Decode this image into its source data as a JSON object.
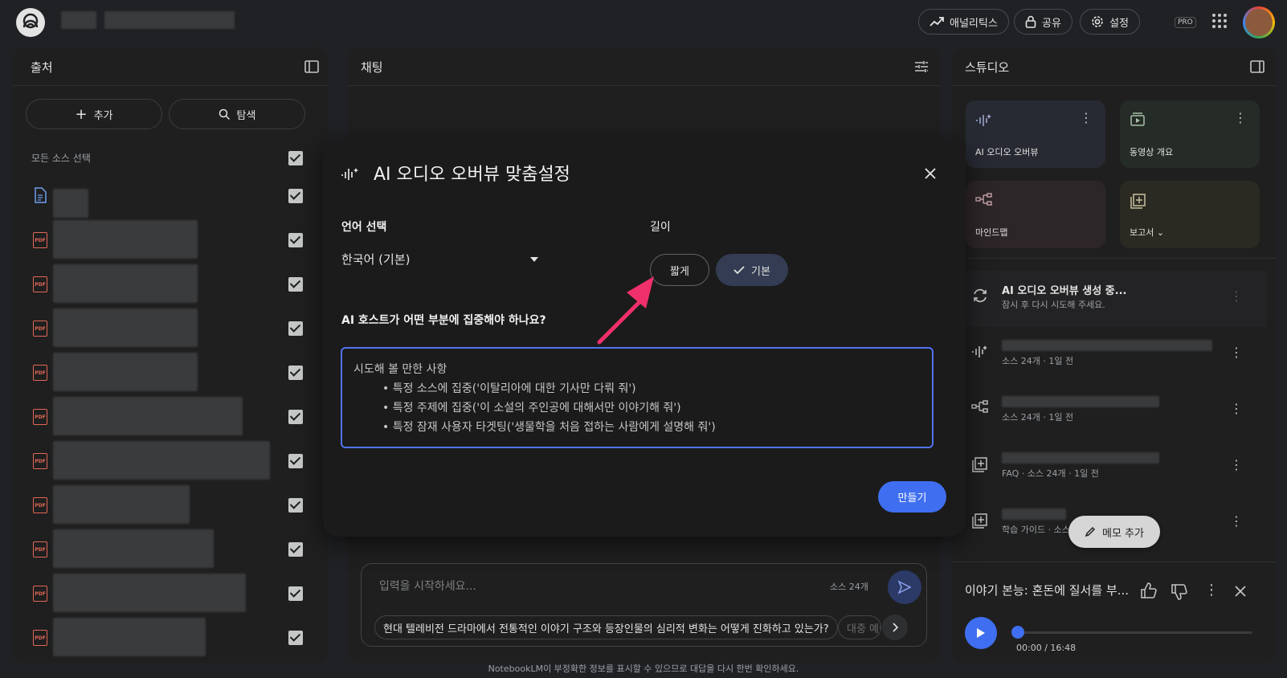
{
  "topbar": {
    "analytics": "애널리틱스",
    "share": "공유",
    "settings": "설정",
    "pro": "PRO"
  },
  "sources": {
    "title": "출처",
    "add": "추가",
    "explore": "탐색",
    "select_all": "모든 소스 선택",
    "pdf_label": "PDF"
  },
  "chat": {
    "title": "채팅",
    "input_placeholder": "입력을 시작하세요...",
    "source_count": "소스 24개",
    "suggestion": "현대 텔레비전 드라마에서 전통적인 이야기 구조와 등장인물의 심리적 변화는 어떻게 진화하고 있는가?",
    "suggestion2": "대중 예술"
  },
  "studio": {
    "title": "스튜디오",
    "cards": {
      "audio": "AI 오디오 오버뷰",
      "video": "동영상 개요",
      "mindmap": "마인드맵",
      "report": "보고서"
    },
    "generating_title": "AI 오디오 오버뷰 생성 중...",
    "generating_sub": "잠시 후 다시 시도해 주세요.",
    "item1_sub": "소스 24개 · 1일 전",
    "item2_sub": "소스 24개 · 1일 전",
    "item3_sub": "FAQ · 소스 24개 · 1일 전",
    "item4_sub": "학습 가이드 · 소스",
    "add_memo": "메모 추가",
    "player_title": "이야기 본능: 혼돈에 질서를 부...",
    "player_time": "00:00 / 16:48"
  },
  "dialog": {
    "title": "AI 오디오 오버뷰 맞춤설정",
    "language_label": "언어 선택",
    "language_value": "한국어 (기본)",
    "length_label": "길이",
    "short": "짧게",
    "default": "기본",
    "focus_question": "AI 호스트가 어떤 부분에 집중해야 하나요?",
    "try_heading": "시도해 볼 만한 사항",
    "try_items": [
      "• 특정 소스에 집중('이탈리아에 대한 기사만 다뤄 줘')",
      "• 특정 주제에 집중('이 소설의 주인공에 대해서만 이야기해 줘')",
      "• 특정 잠재 사용자 타겟팅('생물학을 처음 접하는 사람에게 설명해 줘')"
    ],
    "make": "만들기"
  },
  "footer": "NotebookLM이 부정확한 정보를 표시할 수 있으므로 대답을 다시 한번 확인하세요.",
  "colors": {
    "accent": "#3f6ff0",
    "arrow": "#f0306a",
    "pdf": "#e06856"
  }
}
